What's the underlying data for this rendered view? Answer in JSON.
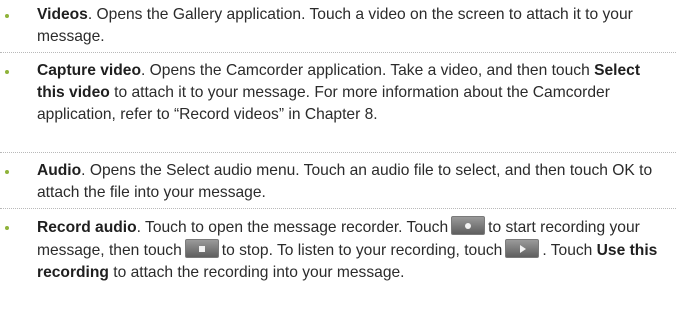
{
  "accent": "#8fb33a",
  "items": [
    {
      "term": "Videos",
      "sep": ". ",
      "desc": " Opens the Gallery application. Touch a video on the screen to attach it to your message."
    },
    {
      "term": "Capture video",
      "sep": ". ",
      "desc1": " Opens the Camcorder application. Take a video, and then touch ",
      "bold": "Select this video",
      "desc2": " to attach it to your message. For more information about the Camcorder application, refer to “Record videos” in Chapter 8."
    },
    {
      "term": "Audio",
      "desc": ". Opens the Select audio menu. Touch an audio file to select, and then touch OK to attach the file into your message."
    },
    {
      "term": "Record audio",
      "p1": ". Touch to open the message recorder. Touch",
      "p2": "to start recording your message, then touch",
      "p3": "to stop. To listen to your recording, touch",
      "p4": ". Touch ",
      "bold": "Use this recording",
      "p5": " to attach the recording into your message.",
      "icons": [
        "record-icon",
        "stop-icon",
        "play-icon"
      ]
    }
  ]
}
